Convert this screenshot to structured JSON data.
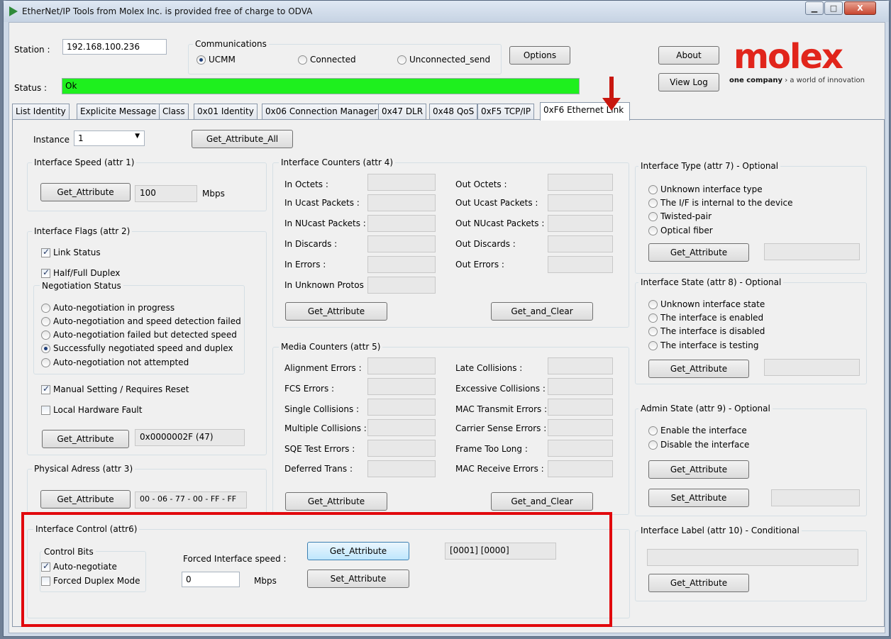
{
  "window": {
    "title": "EtherNet/IP Tools from Molex Inc. is provided free of charge to ODVA",
    "min": "▁",
    "max": "□",
    "close": "X"
  },
  "header": {
    "station_label": "Station :",
    "station_value": "192.168.100.236",
    "comm_title": "Communications",
    "comm_options": [
      "UCMM",
      "Connected",
      "Unconnected_send"
    ],
    "options_button": "Options",
    "about_button": "About",
    "viewlog_button": "View Log",
    "status_label": "Status :",
    "status_value": "Ok",
    "logo_text": "molex",
    "logo_tagline_bold": "one company",
    "logo_tagline_rest": " › a world of innovation"
  },
  "tabs": [
    "List Identity",
    "Explicite Message",
    "Class",
    "0x01 Identity",
    "0x06 Connection Manager",
    "0x47 DLR",
    "0x48 QoS",
    "0xF5 TCP/IP",
    "0xF6 Ethernet Link"
  ],
  "instance": {
    "label": "Instance",
    "value": "1",
    "get_all_button": "Get_Attribute_All"
  },
  "speed": {
    "title": "Interface Speed (attr 1)",
    "button": "Get_Attribute",
    "value": "100",
    "unit": "Mbps"
  },
  "flags": {
    "title": "Interface Flags (attr 2)",
    "link_status": "Link Status",
    "duplex": "Half/Full Duplex",
    "neg_title": "Negotiation Status",
    "neg_options": [
      "Auto-negotiation in progress",
      "Auto-negotiation and speed detection failed",
      "Auto-negotiation failed but detected speed",
      "Successfully negotiated speed and duplex",
      "Auto-negotiation not attempted"
    ],
    "manual": "Manual Setting / Requires Reset",
    "hw_fault": "Local Hardware Fault",
    "button": "Get_Attribute",
    "value": "0x0000002F (47)"
  },
  "phys": {
    "title": "Physical Adress (attr 3)",
    "button": "Get_Attribute",
    "value": "00 - 06 - 77 - 00 - FF - FF"
  },
  "counters": {
    "title": "Interface Counters (attr 4)",
    "left": [
      "In Octets :",
      "In Ucast Packets :",
      "In NUcast Packets :",
      "In Discards :",
      "In Errors :",
      "In Unknown Protos"
    ],
    "right": [
      "Out Octets :",
      "Out Ucast Packets :",
      "Out NUcast Packets :",
      "Out Discards :",
      "Out Errors :"
    ],
    "get_button": "Get_Attribute",
    "clear_button": "Get_and_Clear"
  },
  "media": {
    "title": "Media Counters (attr 5)",
    "left": [
      "Alignment Errors :",
      "FCS Errors :",
      "Single Collisions :",
      "Multiple Collisions :",
      "SQE Test Errors :",
      "Deferred Trans :"
    ],
    "right": [
      "Late Collisions :",
      "Excessive Collisions :",
      "MAC Transmit Errors :",
      "Carrier Sense Errors :",
      "Frame Too Long :",
      "MAC Receive Errors :"
    ],
    "get_button": "Get_Attribute",
    "clear_button": "Get_and_Clear"
  },
  "control": {
    "title": "Interface Control (attr6)",
    "bits_title": "Control Bits",
    "auto": "Auto-negotiate",
    "forced": "Forced Duplex Mode",
    "speed_label": "Forced Interface speed :",
    "speed_value": "0",
    "unit": "Mbps",
    "get_button": "Get_Attribute",
    "set_button": "Set_Attribute",
    "value": "[0001] [0000]"
  },
  "type": {
    "title": "Interface Type (attr 7) - Optional",
    "options": [
      "Unknown interface type",
      "The I/F is internal to the device",
      "Twisted-pair",
      "Optical fiber"
    ],
    "button": "Get_Attribute"
  },
  "state": {
    "title": "Interface State (attr 8) - Optional",
    "options": [
      "Unknown interface state",
      "The interface is enabled",
      "The interface is disabled",
      "The interface is testing"
    ],
    "button": "Get_Attribute"
  },
  "admin": {
    "title": "Admin State (attr 9) - Optional",
    "options": [
      "Enable the interface",
      "Disable the interface"
    ],
    "get_button": "Get_Attribute",
    "set_button": "Set_Attribute"
  },
  "label": {
    "title": "Interface Label (attr 10) - Conditional",
    "button": "Get_Attribute"
  },
  "colors": {
    "status_ok": "#1ef01e",
    "highlight": "#e1090d",
    "logo_red": "#e1251b"
  }
}
